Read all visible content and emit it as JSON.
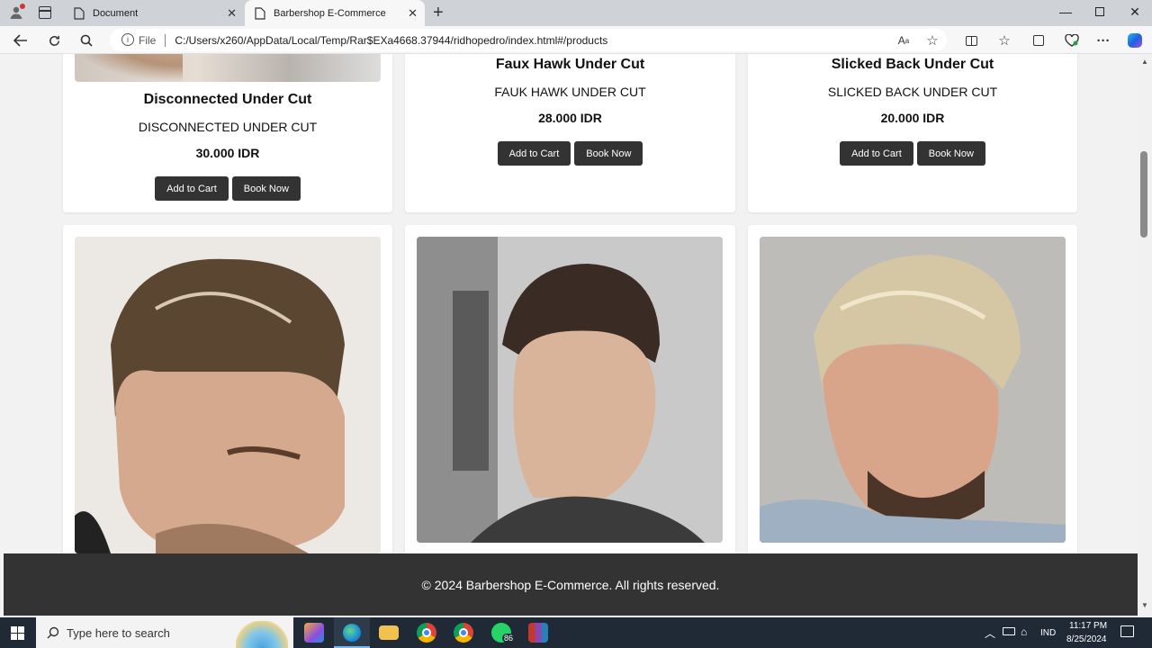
{
  "browser": {
    "tabs": [
      {
        "label": "Document"
      },
      {
        "label": "Barbershop E-Commerce"
      }
    ],
    "address": {
      "scheme_label": "File",
      "url": "C:/Users/x260/AppData/Local/Temp/Rar$EXa4668.37944/ridhopedro/index.html#/products"
    }
  },
  "products_top": [
    {
      "title": "Disconnected Under Cut",
      "subtitle": "DISCONNECTED UNDER CUT",
      "price": "30.000 IDR"
    },
    {
      "title": "Faux Hawk Under Cut",
      "subtitle": "FAUK HAWK UNDER CUT",
      "price": "28.000 IDR"
    },
    {
      "title": "Slicked Back Under Cut",
      "subtitle": "SLICKED BACK UNDER CUT",
      "price": "20.000 IDR"
    }
  ],
  "buttons": {
    "add_to_cart": "Add to Cart",
    "book_now": "Book Now"
  },
  "footer": {
    "text": "© 2024 Barbershop E-Commerce. All rights reserved."
  },
  "taskbar": {
    "search_placeholder": "Type here to search",
    "whatsapp_badge": "86",
    "language": "IND",
    "time": "11:17 PM",
    "date": "8/25/2024"
  },
  "colors": {
    "button_bg": "#333333",
    "footer_bg": "#333333",
    "accent": "#0078d4"
  }
}
